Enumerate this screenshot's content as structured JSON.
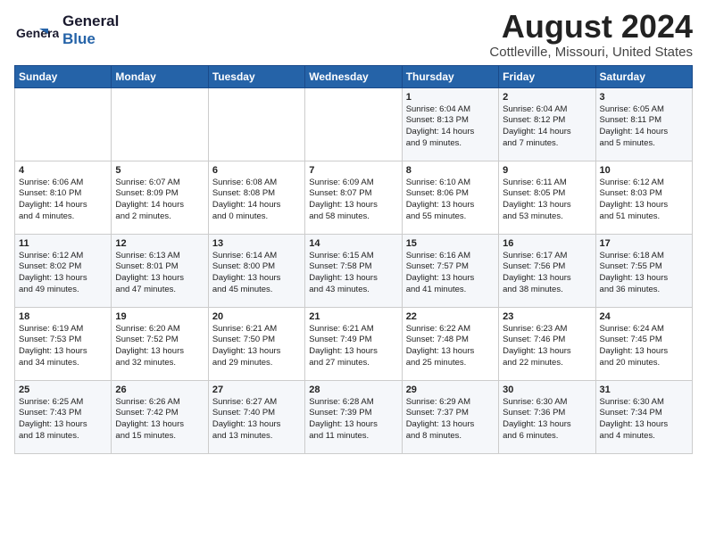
{
  "logo": {
    "line1": "General",
    "line2": "Blue"
  },
  "title": "August 2024",
  "subtitle": "Cottleville, Missouri, United States",
  "header": {
    "days": [
      "Sunday",
      "Monday",
      "Tuesday",
      "Wednesday",
      "Thursday",
      "Friday",
      "Saturday"
    ]
  },
  "weeks": [
    [
      {
        "num": "",
        "text": ""
      },
      {
        "num": "",
        "text": ""
      },
      {
        "num": "",
        "text": ""
      },
      {
        "num": "",
        "text": ""
      },
      {
        "num": "1",
        "text": "Sunrise: 6:04 AM\nSunset: 8:13 PM\nDaylight: 14 hours\nand 9 minutes."
      },
      {
        "num": "2",
        "text": "Sunrise: 6:04 AM\nSunset: 8:12 PM\nDaylight: 14 hours\nand 7 minutes."
      },
      {
        "num": "3",
        "text": "Sunrise: 6:05 AM\nSunset: 8:11 PM\nDaylight: 14 hours\nand 5 minutes."
      }
    ],
    [
      {
        "num": "4",
        "text": "Sunrise: 6:06 AM\nSunset: 8:10 PM\nDaylight: 14 hours\nand 4 minutes."
      },
      {
        "num": "5",
        "text": "Sunrise: 6:07 AM\nSunset: 8:09 PM\nDaylight: 14 hours\nand 2 minutes."
      },
      {
        "num": "6",
        "text": "Sunrise: 6:08 AM\nSunset: 8:08 PM\nDaylight: 14 hours\nand 0 minutes."
      },
      {
        "num": "7",
        "text": "Sunrise: 6:09 AM\nSunset: 8:07 PM\nDaylight: 13 hours\nand 58 minutes."
      },
      {
        "num": "8",
        "text": "Sunrise: 6:10 AM\nSunset: 8:06 PM\nDaylight: 13 hours\nand 55 minutes."
      },
      {
        "num": "9",
        "text": "Sunrise: 6:11 AM\nSunset: 8:05 PM\nDaylight: 13 hours\nand 53 minutes."
      },
      {
        "num": "10",
        "text": "Sunrise: 6:12 AM\nSunset: 8:03 PM\nDaylight: 13 hours\nand 51 minutes."
      }
    ],
    [
      {
        "num": "11",
        "text": "Sunrise: 6:12 AM\nSunset: 8:02 PM\nDaylight: 13 hours\nand 49 minutes."
      },
      {
        "num": "12",
        "text": "Sunrise: 6:13 AM\nSunset: 8:01 PM\nDaylight: 13 hours\nand 47 minutes."
      },
      {
        "num": "13",
        "text": "Sunrise: 6:14 AM\nSunset: 8:00 PM\nDaylight: 13 hours\nand 45 minutes."
      },
      {
        "num": "14",
        "text": "Sunrise: 6:15 AM\nSunset: 7:58 PM\nDaylight: 13 hours\nand 43 minutes."
      },
      {
        "num": "15",
        "text": "Sunrise: 6:16 AM\nSunset: 7:57 PM\nDaylight: 13 hours\nand 41 minutes."
      },
      {
        "num": "16",
        "text": "Sunrise: 6:17 AM\nSunset: 7:56 PM\nDaylight: 13 hours\nand 38 minutes."
      },
      {
        "num": "17",
        "text": "Sunrise: 6:18 AM\nSunset: 7:55 PM\nDaylight: 13 hours\nand 36 minutes."
      }
    ],
    [
      {
        "num": "18",
        "text": "Sunrise: 6:19 AM\nSunset: 7:53 PM\nDaylight: 13 hours\nand 34 minutes."
      },
      {
        "num": "19",
        "text": "Sunrise: 6:20 AM\nSunset: 7:52 PM\nDaylight: 13 hours\nand 32 minutes."
      },
      {
        "num": "20",
        "text": "Sunrise: 6:21 AM\nSunset: 7:50 PM\nDaylight: 13 hours\nand 29 minutes."
      },
      {
        "num": "21",
        "text": "Sunrise: 6:21 AM\nSunset: 7:49 PM\nDaylight: 13 hours\nand 27 minutes."
      },
      {
        "num": "22",
        "text": "Sunrise: 6:22 AM\nSunset: 7:48 PM\nDaylight: 13 hours\nand 25 minutes."
      },
      {
        "num": "23",
        "text": "Sunrise: 6:23 AM\nSunset: 7:46 PM\nDaylight: 13 hours\nand 22 minutes."
      },
      {
        "num": "24",
        "text": "Sunrise: 6:24 AM\nSunset: 7:45 PM\nDaylight: 13 hours\nand 20 minutes."
      }
    ],
    [
      {
        "num": "25",
        "text": "Sunrise: 6:25 AM\nSunset: 7:43 PM\nDaylight: 13 hours\nand 18 minutes."
      },
      {
        "num": "26",
        "text": "Sunrise: 6:26 AM\nSunset: 7:42 PM\nDaylight: 13 hours\nand 15 minutes."
      },
      {
        "num": "27",
        "text": "Sunrise: 6:27 AM\nSunset: 7:40 PM\nDaylight: 13 hours\nand 13 minutes."
      },
      {
        "num": "28",
        "text": "Sunrise: 6:28 AM\nSunset: 7:39 PM\nDaylight: 13 hours\nand 11 minutes."
      },
      {
        "num": "29",
        "text": "Sunrise: 6:29 AM\nSunset: 7:37 PM\nDaylight: 13 hours\nand 8 minutes."
      },
      {
        "num": "30",
        "text": "Sunrise: 6:30 AM\nSunset: 7:36 PM\nDaylight: 13 hours\nand 6 minutes."
      },
      {
        "num": "31",
        "text": "Sunrise: 6:30 AM\nSunset: 7:34 PM\nDaylight: 13 hours\nand 4 minutes."
      }
    ]
  ],
  "colors": {
    "header_bg": "#2563a8",
    "header_text": "#ffffff",
    "odd_row": "#f5f7fa",
    "even_row": "#ffffff",
    "border": "#cccccc"
  }
}
